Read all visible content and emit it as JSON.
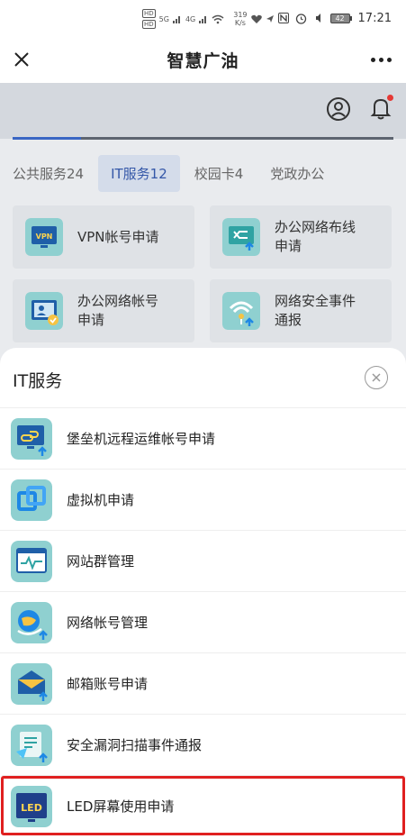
{
  "status_bar": {
    "hd1": "HD",
    "hd2": "HD",
    "net1": "5G",
    "net2": "4G",
    "speed_value": "319",
    "speed_unit": "K/s",
    "battery": "42",
    "time": "17:21"
  },
  "header": {
    "title": "智慧广油"
  },
  "page": {
    "progress_value": 0.18,
    "tabs": [
      {
        "label": "公共服务24"
      },
      {
        "label": "IT服务12"
      },
      {
        "label": "校园卡4"
      },
      {
        "label": "党政办公"
      }
    ],
    "cards": [
      {
        "label": "VPN帐号申请",
        "icon": "vpn-icon"
      },
      {
        "label": "办公网络布线申请",
        "icon": "network-wiring-icon"
      },
      {
        "label": "办公网络帐号申请",
        "icon": "network-account-icon"
      },
      {
        "label": "网络安全事件通报",
        "icon": "security-event-icon"
      }
    ]
  },
  "sheet": {
    "title": "IT服务",
    "items": [
      {
        "label": "堡垒机远程运维帐号申请",
        "icon": "bastion-host-icon"
      },
      {
        "label": "虚拟机申请",
        "icon": "virtual-machine-icon"
      },
      {
        "label": "网站群管理",
        "icon": "website-group-icon"
      },
      {
        "label": "网络帐号管理",
        "icon": "network-account-manage-icon"
      },
      {
        "label": "邮箱账号申请",
        "icon": "mailbox-icon"
      },
      {
        "label": "安全漏洞扫描事件通报",
        "icon": "vulnerability-scan-icon"
      },
      {
        "label": "LED屏幕使用申请",
        "icon": "led-screen-icon"
      }
    ]
  },
  "colors": {
    "accent": "#3a66c4",
    "highlight": "#e02020",
    "icon_teal": "#4fc3c3",
    "icon_blue": "#1e88e5"
  }
}
